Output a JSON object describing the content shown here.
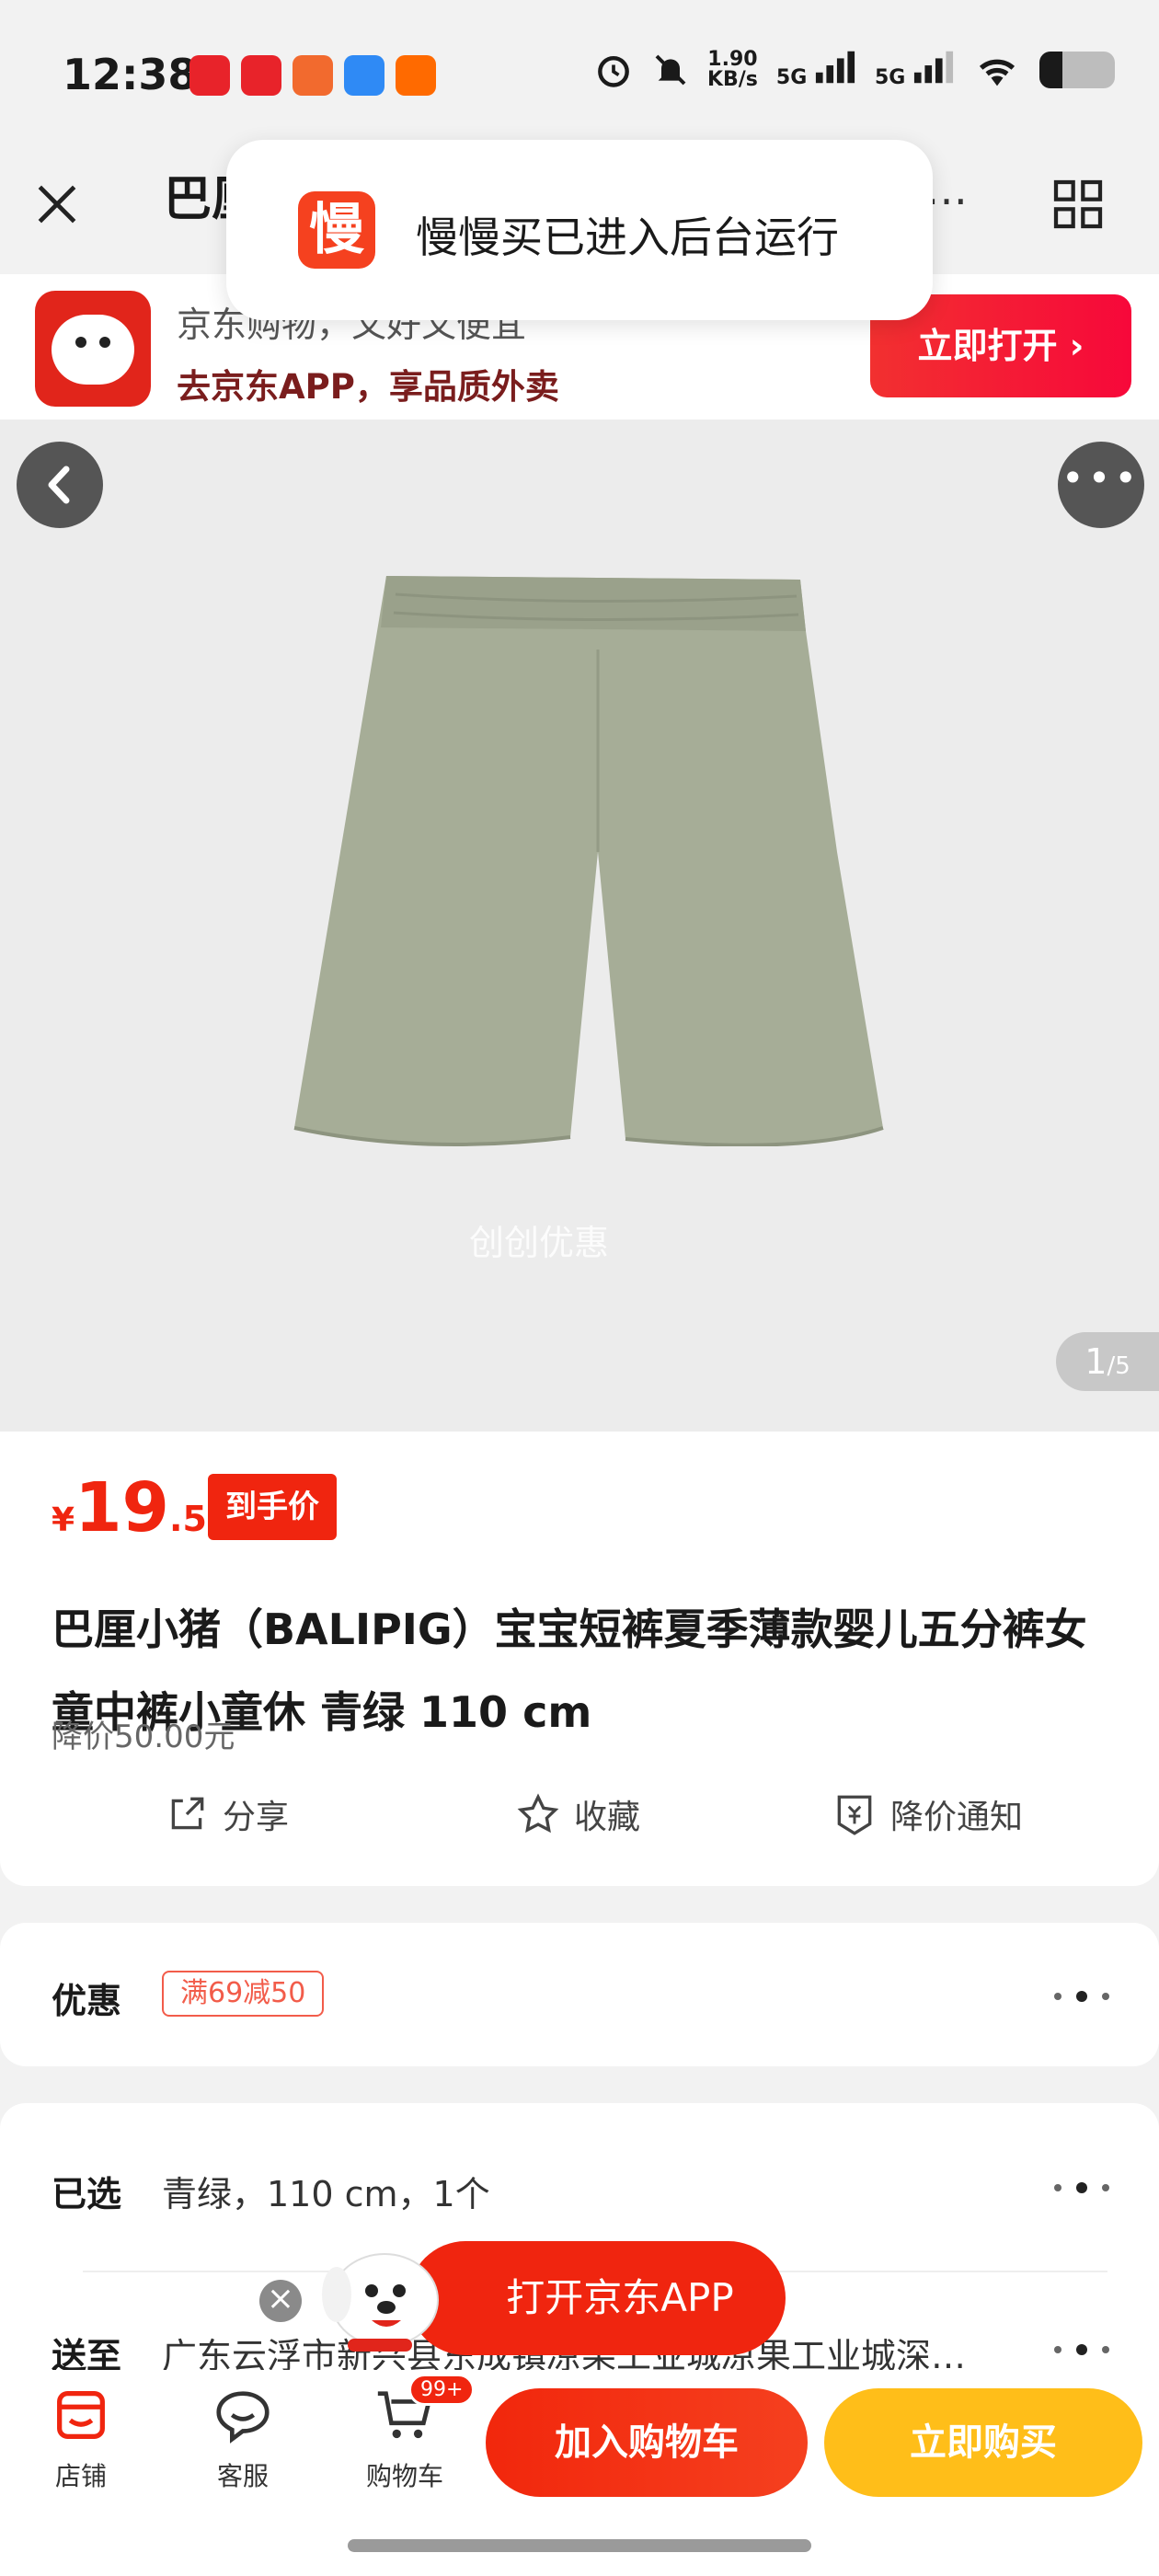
{
  "status_bar": {
    "time": "12:38",
    "net_speed_value": "1.90",
    "net_speed_unit": "KB/s",
    "sim1": "5G",
    "sim2": "5G"
  },
  "nav": {
    "title": "巴厘",
    "title_tail": "季…"
  },
  "toast": {
    "logo_char": "慢",
    "message": "慢慢买已进入后台运行"
  },
  "banner": {
    "line1": "京东购物，又好又便宜",
    "line2": "去京东APP，享品质外卖",
    "open_button": "立即打开 ›"
  },
  "gallery": {
    "watermark": "创创优惠",
    "current": "1",
    "total": "/5",
    "more": "•••"
  },
  "product": {
    "price_currency": "¥",
    "price_int": "19",
    "price_dec": ".50",
    "price_tag": "到手价",
    "title": "巴厘小猪（BALIPIG）宝宝短裤夏季薄款婴儿五分裤女童中裤小童休 青绿 110 cm",
    "price_drop": "降价50.00元",
    "actions": {
      "share": "分享",
      "favorite": "收藏",
      "notify": "降价通知"
    }
  },
  "promo": {
    "label": "优惠",
    "coupon": "满69减50"
  },
  "selection": {
    "selected_label": "已选",
    "selected_value": "青绿，110 cm，1个",
    "ship_label": "送至",
    "ship_value": "广东云浮市新兴县东成镇凉果工业城凉果工业城深…"
  },
  "floating": {
    "open_app": "打开京东APP",
    "close": "×"
  },
  "bottom_bar": {
    "store": "店铺",
    "service": "客服",
    "cart": "购物车",
    "cart_badge": "99+",
    "add_to_cart": "加入购物车",
    "buy_now": "立即购买"
  },
  "colors": {
    "jd_red": "#f0250f",
    "buy_yellow": "#ffbe19",
    "shorts_green": "#a6ad97"
  }
}
